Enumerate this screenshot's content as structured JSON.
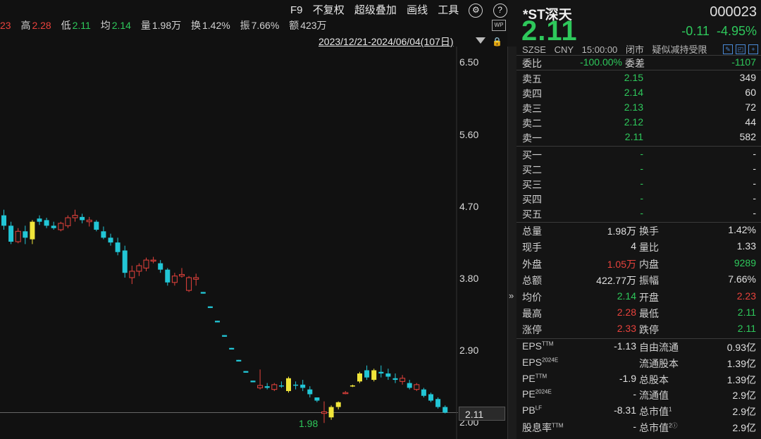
{
  "infobar": {
    "partial": "23",
    "high_label": "高",
    "high": "2.28",
    "low_label": "低",
    "low": "2.11",
    "avg_label": "均",
    "avg": "2.14",
    "vol_label": "量",
    "vol": "1.98万",
    "turn_label": "换",
    "turn": "1.42%",
    "amp_label": "振",
    "amp": "7.66%",
    "amt_label": "额",
    "amt": "423万"
  },
  "toolbar": {
    "f9": "F9",
    "adjust": "不复权",
    "overlay": "超级叠加",
    "draw": "画线",
    "tools": "工具",
    "gear_icon": "gear-icon",
    "help_icon": "help-icon",
    "chevron": "chevron-right-icon"
  },
  "date_range": "2023/12/21-2024/06/04(107日)",
  "wp_badge": "WP",
  "y_ticks": [
    "6.50",
    "5.60",
    "4.70",
    "3.80",
    "2.90",
    "2.00"
  ],
  "current_price_tag": "2.11",
  "low_marker": "1.98",
  "colors": {
    "up": "#e8423c",
    "down": "#2ec85b",
    "cyan": "#22c6d6",
    "yellow": "#f0e53a",
    "bg": "#141414"
  },
  "chart_data": {
    "type": "candlestick",
    "ylim": [
      2.0,
      6.5
    ],
    "candles": [
      {
        "o": 4.58,
        "h": 4.65,
        "l": 4.4,
        "c": 4.45,
        "k": "d"
      },
      {
        "o": 4.45,
        "h": 4.5,
        "l": 4.22,
        "c": 4.25,
        "k": "d"
      },
      {
        "o": 4.25,
        "h": 4.42,
        "l": 4.23,
        "c": 4.38,
        "k": "u"
      },
      {
        "o": 4.38,
        "h": 4.45,
        "l": 4.22,
        "c": 4.3,
        "k": "d"
      },
      {
        "o": 4.28,
        "h": 4.52,
        "l": 4.22,
        "c": 4.5,
        "k": "y"
      },
      {
        "o": 4.5,
        "h": 4.58,
        "l": 4.46,
        "c": 4.54,
        "k": "d"
      },
      {
        "o": 4.52,
        "h": 4.55,
        "l": 4.42,
        "c": 4.45,
        "k": "d"
      },
      {
        "o": 4.45,
        "h": 4.5,
        "l": 4.4,
        "c": 4.42,
        "k": "d"
      },
      {
        "o": 4.4,
        "h": 4.5,
        "l": 4.38,
        "c": 4.48,
        "k": "u"
      },
      {
        "o": 4.45,
        "h": 4.58,
        "l": 4.42,
        "c": 4.55,
        "k": "u"
      },
      {
        "o": 4.55,
        "h": 4.65,
        "l": 4.5,
        "c": 4.58,
        "k": "u"
      },
      {
        "o": 4.56,
        "h": 4.6,
        "l": 4.48,
        "c": 4.52,
        "k": "d"
      },
      {
        "o": 4.52,
        "h": 4.56,
        "l": 4.44,
        "c": 4.5,
        "k": "u"
      },
      {
        "o": 4.5,
        "h": 4.52,
        "l": 4.38,
        "c": 4.4,
        "k": "d"
      },
      {
        "o": 4.38,
        "h": 4.44,
        "l": 4.28,
        "c": 4.3,
        "k": "d"
      },
      {
        "o": 4.3,
        "h": 4.35,
        "l": 4.2,
        "c": 4.24,
        "k": "d"
      },
      {
        "o": 4.24,
        "h": 4.3,
        "l": 4.08,
        "c": 4.12,
        "k": "d"
      },
      {
        "o": 4.14,
        "h": 4.2,
        "l": 3.8,
        "c": 3.86,
        "k": "d"
      },
      {
        "o": 3.8,
        "h": 3.95,
        "l": 3.72,
        "c": 3.88,
        "k": "u"
      },
      {
        "o": 3.88,
        "h": 3.98,
        "l": 3.82,
        "c": 3.95,
        "k": "u"
      },
      {
        "o": 3.92,
        "h": 4.05,
        "l": 3.88,
        "c": 4.02,
        "k": "u"
      },
      {
        "o": 4.02,
        "h": 4.06,
        "l": 3.98,
        "c": 4.02,
        "k": "u"
      },
      {
        "o": 3.98,
        "h": 4.02,
        "l": 3.86,
        "c": 3.9,
        "k": "d"
      },
      {
        "o": 3.9,
        "h": 3.92,
        "l": 3.7,
        "c": 3.74,
        "k": "d"
      },
      {
        "o": 3.74,
        "h": 3.86,
        "l": 3.7,
        "c": 3.82,
        "k": "u"
      },
      {
        "o": 3.82,
        "h": 3.92,
        "l": 3.8,
        "c": 3.84,
        "k": "u"
      },
      {
        "o": 3.8,
        "h": 3.82,
        "l": 3.62,
        "c": 3.64,
        "k": "u"
      },
      {
        "o": 3.78,
        "h": 3.85,
        "l": 3.7,
        "c": 3.8,
        "k": "u"
      },
      {
        "o": 3.62,
        "h": 3.62,
        "l": 3.6,
        "c": 3.6,
        "k": "d"
      },
      {
        "o": 3.44,
        "h": 3.44,
        "l": 3.42,
        "c": 3.42,
        "k": "d"
      },
      {
        "o": 3.26,
        "h": 3.26,
        "l": 3.24,
        "c": 3.24,
        "k": "d"
      },
      {
        "o": 3.08,
        "h": 3.08,
        "l": 3.06,
        "c": 3.06,
        "k": "d"
      },
      {
        "o": 2.92,
        "h": 2.92,
        "l": 2.9,
        "c": 2.9,
        "k": "d"
      },
      {
        "o": 2.77,
        "h": 2.77,
        "l": 2.75,
        "c": 2.75,
        "k": "d"
      },
      {
        "o": 2.63,
        "h": 2.63,
        "l": 2.61,
        "c": 2.61,
        "k": "d"
      },
      {
        "o": 2.51,
        "h": 2.51,
        "l": 2.49,
        "c": 2.49,
        "k": "d"
      },
      {
        "o": 2.45,
        "h": 2.65,
        "l": 2.4,
        "c": 2.42,
        "k": "u"
      },
      {
        "o": 2.44,
        "h": 2.48,
        "l": 2.4,
        "c": 2.42,
        "k": "d"
      },
      {
        "o": 2.4,
        "h": 2.48,
        "l": 2.38,
        "c": 2.46,
        "k": "u"
      },
      {
        "o": 2.45,
        "h": 2.5,
        "l": 2.42,
        "c": 2.45,
        "k": "d"
      },
      {
        "o": 2.38,
        "h": 2.56,
        "l": 2.36,
        "c": 2.54,
        "k": "y"
      },
      {
        "o": 2.46,
        "h": 2.5,
        "l": 2.4,
        "c": 2.45,
        "k": "d"
      },
      {
        "o": 2.46,
        "h": 2.52,
        "l": 2.38,
        "c": 2.42,
        "k": "d"
      },
      {
        "o": 2.4,
        "h": 2.44,
        "l": 2.3,
        "c": 2.34,
        "k": "d"
      },
      {
        "o": 2.3,
        "h": 2.3,
        "l": 2.24,
        "c": 2.26,
        "k": "d"
      },
      {
        "o": 2.1,
        "h": 2.25,
        "l": 1.98,
        "c": 2.12,
        "k": "u"
      },
      {
        "o": 2.05,
        "h": 2.2,
        "l": 2.02,
        "c": 2.18,
        "k": "y"
      },
      {
        "o": 2.18,
        "h": 2.25,
        "l": 2.15,
        "c": 2.24,
        "k": "y"
      },
      {
        "o": 2.36,
        "h": 2.38,
        "l": 2.34,
        "c": 2.36,
        "k": "u"
      },
      {
        "o": 2.44,
        "h": 2.46,
        "l": 2.43,
        "c": 2.45,
        "k": "y"
      },
      {
        "o": 2.5,
        "h": 2.62,
        "l": 2.48,
        "c": 2.6,
        "k": "y"
      },
      {
        "o": 2.64,
        "h": 2.7,
        "l": 2.52,
        "c": 2.55,
        "k": "d"
      },
      {
        "o": 2.52,
        "h": 2.66,
        "l": 2.5,
        "c": 2.64,
        "k": "y"
      },
      {
        "o": 2.62,
        "h": 2.7,
        "l": 2.55,
        "c": 2.6,
        "k": "d"
      },
      {
        "o": 2.6,
        "h": 2.66,
        "l": 2.52,
        "c": 2.56,
        "k": "d"
      },
      {
        "o": 2.54,
        "h": 2.6,
        "l": 2.48,
        "c": 2.52,
        "k": "d"
      },
      {
        "o": 2.5,
        "h": 2.58,
        "l": 2.46,
        "c": 2.54,
        "k": "u"
      },
      {
        "o": 2.48,
        "h": 2.52,
        "l": 2.4,
        "c": 2.42,
        "k": "d"
      },
      {
        "o": 2.4,
        "h": 2.48,
        "l": 2.38,
        "c": 2.46,
        "k": "u"
      },
      {
        "o": 2.4,
        "h": 2.42,
        "l": 2.3,
        "c": 2.32,
        "k": "d"
      },
      {
        "o": 2.34,
        "h": 2.36,
        "l": 2.24,
        "c": 2.26,
        "k": "d"
      },
      {
        "o": 2.28,
        "h": 2.3,
        "l": 2.16,
        "c": 2.18,
        "k": "d"
      },
      {
        "o": 2.18,
        "h": 2.2,
        "l": 2.1,
        "c": 2.11,
        "k": "d"
      }
    ]
  },
  "panel": {
    "name": "*ST深天",
    "code": "000023",
    "price": "2.11",
    "change": "-0.11",
    "change_pct": "-4.95%",
    "exchange": "SZSE",
    "currency": "CNY",
    "time": "15:00:00",
    "status": "闭市",
    "tag": "疑似减持受限",
    "weibi_label": "委比",
    "weibi": "-100.00%",
    "weicha_label": "委差",
    "weicha": "-1107",
    "asks": [
      {
        "label": "卖五",
        "price": "2.15",
        "vol": "349"
      },
      {
        "label": "卖四",
        "price": "2.14",
        "vol": "60"
      },
      {
        "label": "卖三",
        "price": "2.13",
        "vol": "72"
      },
      {
        "label": "卖二",
        "price": "2.12",
        "vol": "44"
      },
      {
        "label": "卖一",
        "price": "2.11",
        "vol": "582"
      }
    ],
    "bids": [
      {
        "label": "买一",
        "price": "-",
        "vol": "-"
      },
      {
        "label": "买二",
        "price": "-",
        "vol": "-"
      },
      {
        "label": "买三",
        "price": "-",
        "vol": "-"
      },
      {
        "label": "买四",
        "price": "-",
        "vol": "-"
      },
      {
        "label": "买五",
        "price": "-",
        "vol": "-"
      }
    ],
    "stats": [
      {
        "l1": "总量",
        "v1": "1.98万",
        "c1": "white",
        "l2": "换手",
        "v2": "1.42%",
        "c2": "white"
      },
      {
        "l1": "现手",
        "v1": "4",
        "c1": "white",
        "l2": "量比",
        "v2": "1.33",
        "c2": "white"
      },
      {
        "l1": "外盘",
        "v1": "1.05万",
        "c1": "red",
        "l2": "内盘",
        "v2": "9289",
        "c2": "green"
      },
      {
        "l1": "总额",
        "v1": "422.77万",
        "c1": "white",
        "l2": "振幅",
        "v2": "7.66%",
        "c2": "white"
      },
      {
        "l1": "均价",
        "v1": "2.14",
        "c1": "green",
        "l2": "开盘",
        "v2": "2.23",
        "c2": "red"
      },
      {
        "l1": "最高",
        "v1": "2.28",
        "c1": "red",
        "l2": "最低",
        "v2": "2.11",
        "c2": "green"
      },
      {
        "l1": "涨停",
        "v1": "2.33",
        "c1": "red",
        "l2": "跌停",
        "v2": "2.11",
        "c2": "green"
      }
    ],
    "fund": [
      {
        "l1": "EPS",
        "s1": "TTM",
        "v1": "-1.13",
        "l2": "自由流通",
        "s2": "",
        "v2": "0.93亿"
      },
      {
        "l1": "EPS",
        "s1": "2024E",
        "v1": "",
        "l2": "流通股本",
        "s2": "",
        "v2": "1.39亿"
      },
      {
        "l1": "PE",
        "s1": "TTM",
        "v1": "-1.9",
        "l2": "总股本",
        "s2": "",
        "v2": "1.39亿"
      },
      {
        "l1": "PE",
        "s1": "2024E",
        "v1": "-",
        "l2": "流通值",
        "s2": "",
        "v2": "2.9亿"
      },
      {
        "l1": "PB",
        "s1": "LF",
        "v1": "-8.31",
        "l2": "总市值",
        "s2": "1",
        "v2": "2.9亿"
      },
      {
        "l1": "股息率",
        "s1": "TTM",
        "v1": "-",
        "l2": "总市值",
        "s2": "2ⓘ",
        "v2": "2.9亿"
      }
    ]
  },
  "collapse_icon": "»"
}
